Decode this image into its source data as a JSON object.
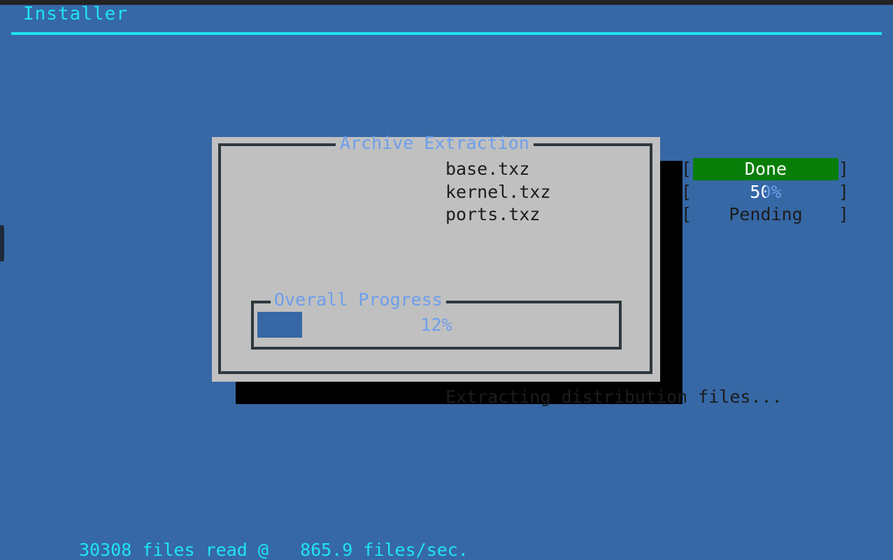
{
  "colors": {
    "background_blue": "#3668a6",
    "dialog_gray": "#c0c0c0",
    "border_dark": "#2f383c",
    "accent_cyan": "#20e4f0",
    "title_blue": "#6d9eeb",
    "done_green": "#087e08",
    "progress_blue": "#3668a6",
    "top_strip": "#232323",
    "shadow": "#000000"
  },
  "header": {
    "title": "Installer"
  },
  "dialog": {
    "title": "Archive Extraction",
    "status_text": "Extracting distribution files...",
    "bracket_left": "[",
    "bracket_right": "]",
    "archives": [
      {
        "name": "base.txz",
        "state_label": "Done",
        "percent": 100,
        "fill_color": "#087e08",
        "label_color": "#ffffff",
        "has_fill": true
      },
      {
        "name": "kernel.txz",
        "state_label": "50%",
        "percent": 50,
        "fill_color": "#3668a6",
        "label_color": "#6d9eeb",
        "has_fill": true
      },
      {
        "name": "ports.txz",
        "state_label": "Pending",
        "percent": 0,
        "fill_color": "#3668a6",
        "label_color": "#1c1c1c",
        "has_fill": false
      }
    ],
    "overall": {
      "legend": "Overall Progress",
      "percent_label": "12%",
      "percent": 12
    }
  },
  "footer": {
    "files_counter": "30308 files read @   865.9 files/sec.",
    "files_read": 30308,
    "rate": "865.9 files/sec."
  }
}
